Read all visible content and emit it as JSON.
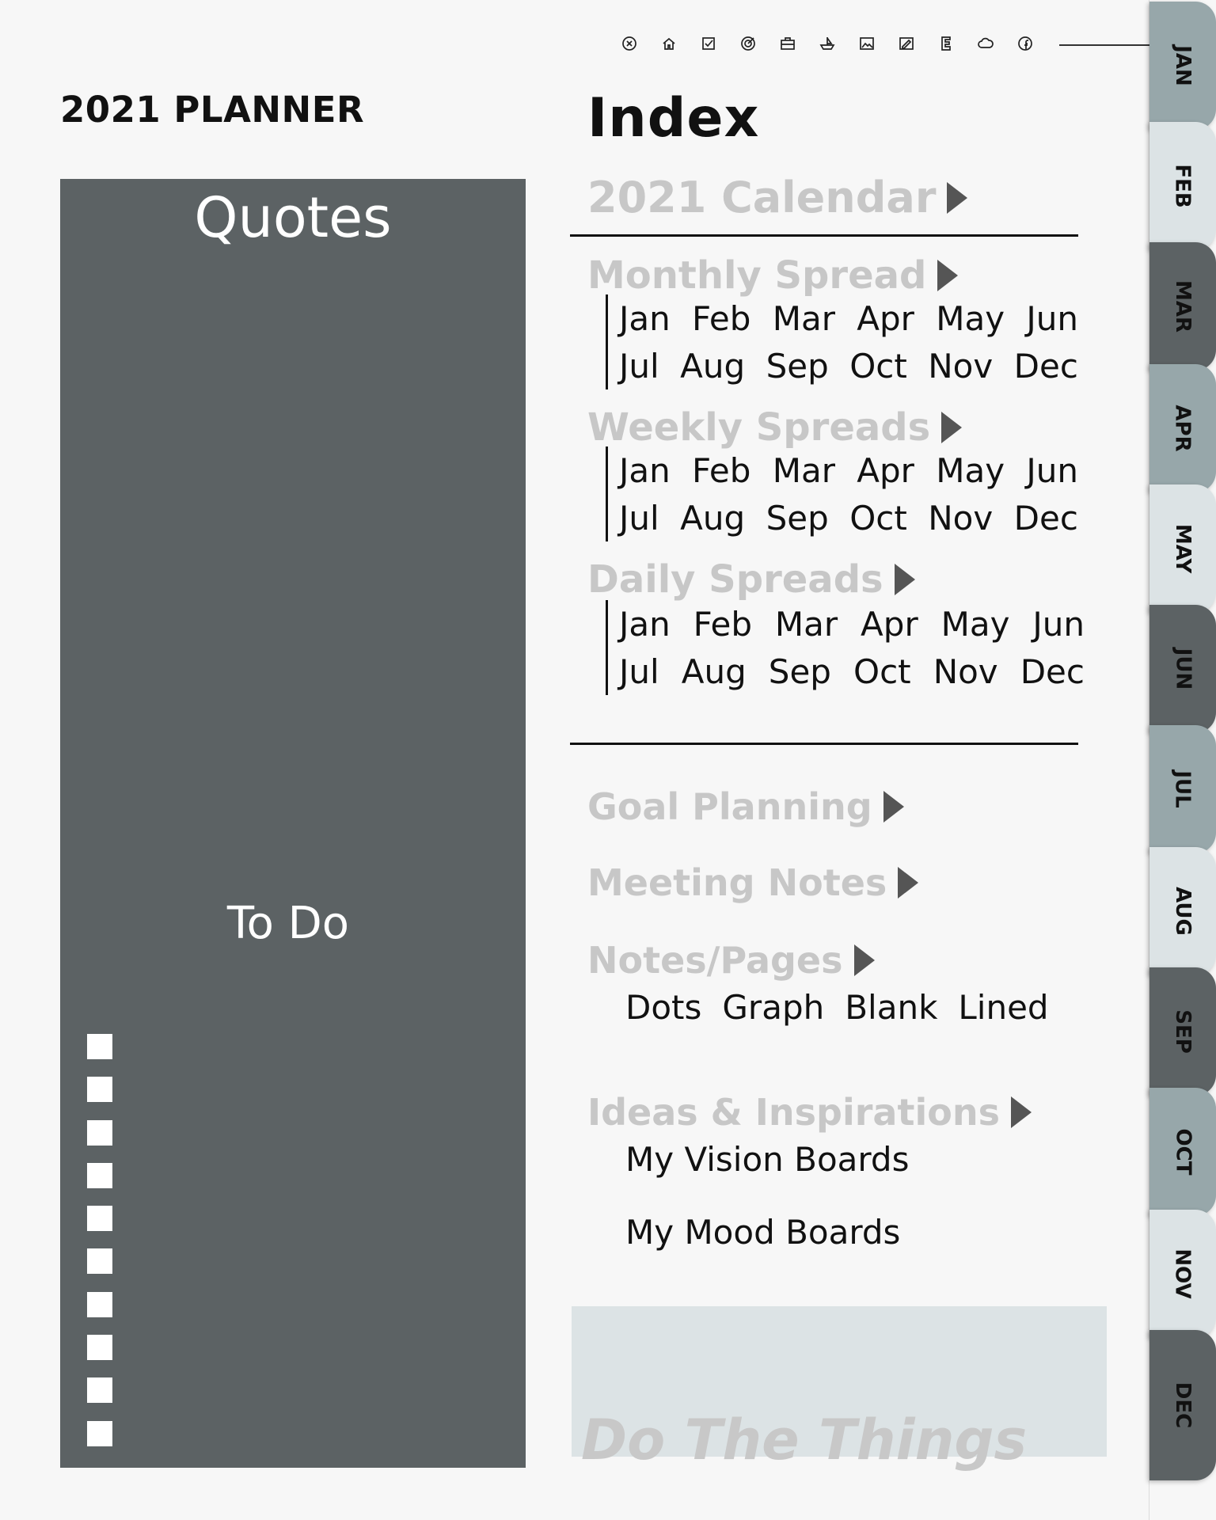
{
  "toolbar": {
    "icons": [
      "close-circle-icon",
      "home-icon",
      "checkbox-icon",
      "target-icon",
      "briefcase-icon",
      "boat-icon",
      "image-icon",
      "sketch-icon",
      "journal-icon",
      "cloud-icon",
      "facebook-icon"
    ]
  },
  "header": {
    "planner_title": "2021 PLANNER"
  },
  "left_panel": {
    "quotes_label": "Quotes",
    "todo_label": "To Do",
    "checkbox_count": 10
  },
  "index": {
    "title": "Index",
    "calendar_label": "2021 Calendar",
    "monthly_label": "Monthly Spread",
    "weekly_label": "Weekly Spreads",
    "daily_label": "Daily Spreads",
    "months_row1": [
      "Jan",
      "Feb",
      "Mar",
      "Apr",
      "May",
      "Jun"
    ],
    "months_row2": [
      "Jul",
      "Aug",
      "Sep",
      "Oct",
      "Nov",
      "Dec"
    ],
    "goal_label": "Goal Planning",
    "meeting_label": "Meeting Notes",
    "notes_label": "Notes/Pages",
    "notes_types": [
      "Dots",
      "Graph",
      "Blank",
      "Lined"
    ],
    "ideas_label": "Ideas & Inspirations",
    "vision_label": "My Vision Boards",
    "mood_label": "My Mood Boards",
    "do_things_label": "Do The Things"
  },
  "tabs": [
    "JAN",
    "FEB",
    "MAR",
    "APR",
    "MAY",
    "JUN",
    "JUL",
    "AUG",
    "SEP",
    "OCT",
    "NOV",
    "DEC"
  ],
  "colors": {
    "panel": "#5c6264",
    "tab_dark": "#5c6264",
    "tab_light": "#97a7aa",
    "tab_pale": "#dce3e5",
    "heading_gray": "#c7c7c7"
  }
}
